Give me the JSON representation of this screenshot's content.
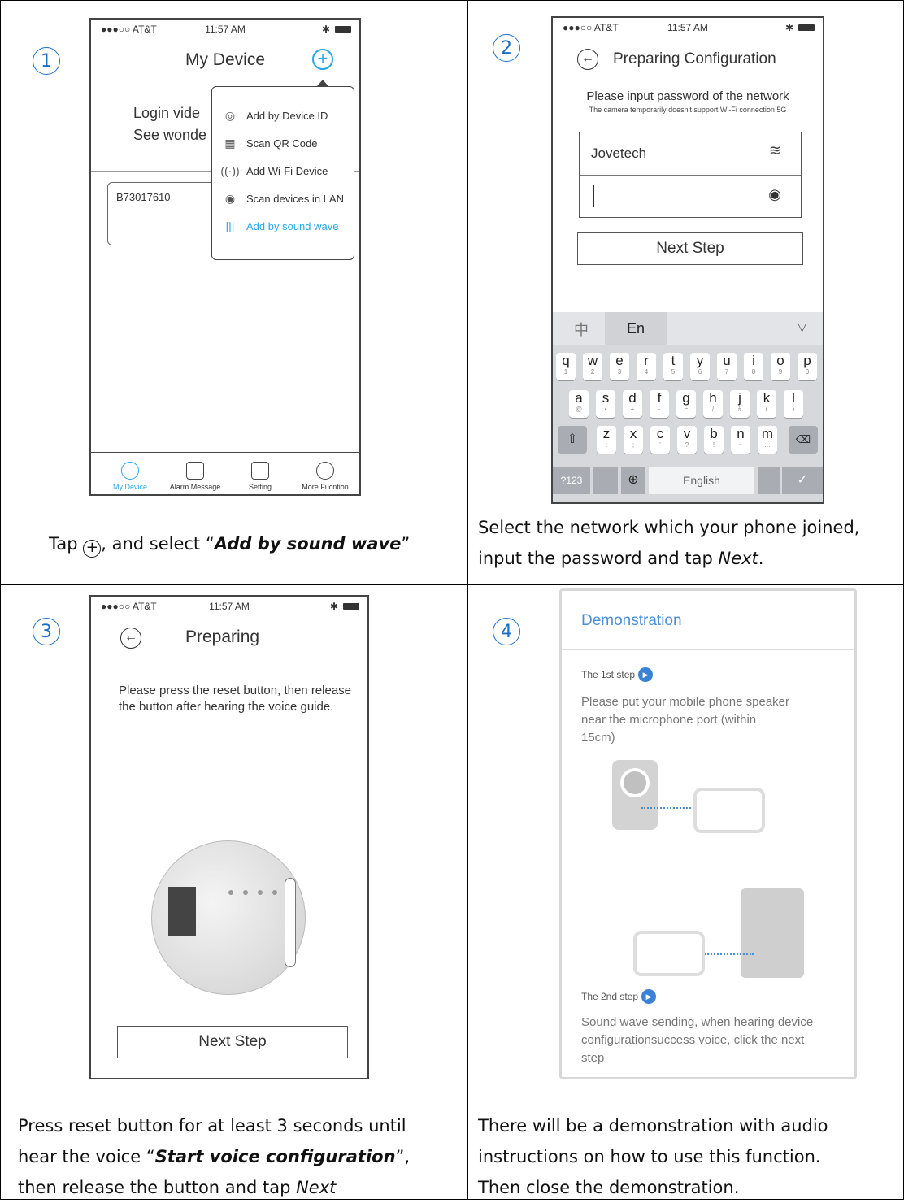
{
  "cells": [
    {
      "number": "1",
      "caption_pre": "Tap ",
      "caption_strong": "Add by sound wave",
      "caption_mid": ", and select “",
      "caption_post": "”"
    },
    {
      "number": "2",
      "caption_line1": "Select the network which your phone joined,",
      "caption_line2_pre": "input the password and tap ",
      "caption_line2_em": "Next",
      "caption_line2_post": "."
    },
    {
      "number": "3",
      "caption_line1": "Press reset button for at least 3 seconds until",
      "caption_line2_pre": "hear the voice “",
      "caption_line2_strong": "Start voice configuration",
      "caption_line2_post": "”,",
      "caption_line3_pre": "then release the button and tap ",
      "caption_line3_em": "Next"
    },
    {
      "number": "4",
      "caption_line1": "There will be a demonstration with audio",
      "caption_line2": "instructions on how to use this function.",
      "caption_line3": "Then close the demonstration."
    }
  ],
  "status_bar": {
    "carrier": "●●●○○ AT&T",
    "time": "11:57 AM"
  },
  "screen1": {
    "title": "My Device",
    "bg_text_line1": "Login vide",
    "bg_text_line2": "See wonde",
    "device_id": "B73017610",
    "menu": [
      "Add by Device ID",
      "Scan QR Code",
      "Add Wi-Fi Device",
      "Scan devices in LAN",
      "Add by sound wave"
    ],
    "menu_icons": [
      "device-id-icon",
      "qr-code-icon",
      "wifi-device-icon",
      "lan-scan-icon",
      "sound-wave-icon"
    ],
    "tabs": [
      "My Device",
      "Alarm Message",
      "Setting",
      "More Fucntion"
    ],
    "accent": "#2aa7e8"
  },
  "screen2": {
    "title": "Preparing  Configuration",
    "prompt": "Please input password of the network",
    "note": "The camera temporarily doesn't support Wi-Fi connection 5G",
    "ssid": "Jovetech",
    "next": "Next Step",
    "lang_cn": "中",
    "lang_en": "En",
    "row1": [
      "q",
      "w",
      "e",
      "r",
      "t",
      "y",
      "u",
      "i",
      "o",
      "p"
    ],
    "row1_sub": [
      "1",
      "2",
      "3",
      "4",
      "5",
      "6",
      "7",
      "8",
      "9",
      "0"
    ],
    "row2": [
      "a",
      "s",
      "d",
      "f",
      "g",
      "h",
      "j",
      "k",
      "l"
    ],
    "row2_sub": [
      "@",
      "•",
      "+",
      "-",
      "=",
      "/",
      "#",
      "(",
      ")"
    ],
    "row3": [
      "z",
      "x",
      "c",
      "v",
      "b",
      "n",
      "m"
    ],
    "row3_sub": [
      ":",
      ";",
      "'",
      "?",
      "!",
      "~",
      "…"
    ],
    "key_123": "?123",
    "key_space": "English"
  },
  "screen3": {
    "title": "Preparing",
    "instruction": "Please press the reset button, then release the button after hearing the voice guide.",
    "next": "Next Step"
  },
  "screen4": {
    "title": "Demonstration",
    "step1_label": "The 1st step",
    "step1_text": "Please put your mobile phone speaker near the microphone port (within 15cm)",
    "step2_label": "The 2nd step",
    "step2_text": "Sound wave sending, when hearing device configurationsuccess voice, click the next step",
    "accent": "#4a90d9"
  }
}
